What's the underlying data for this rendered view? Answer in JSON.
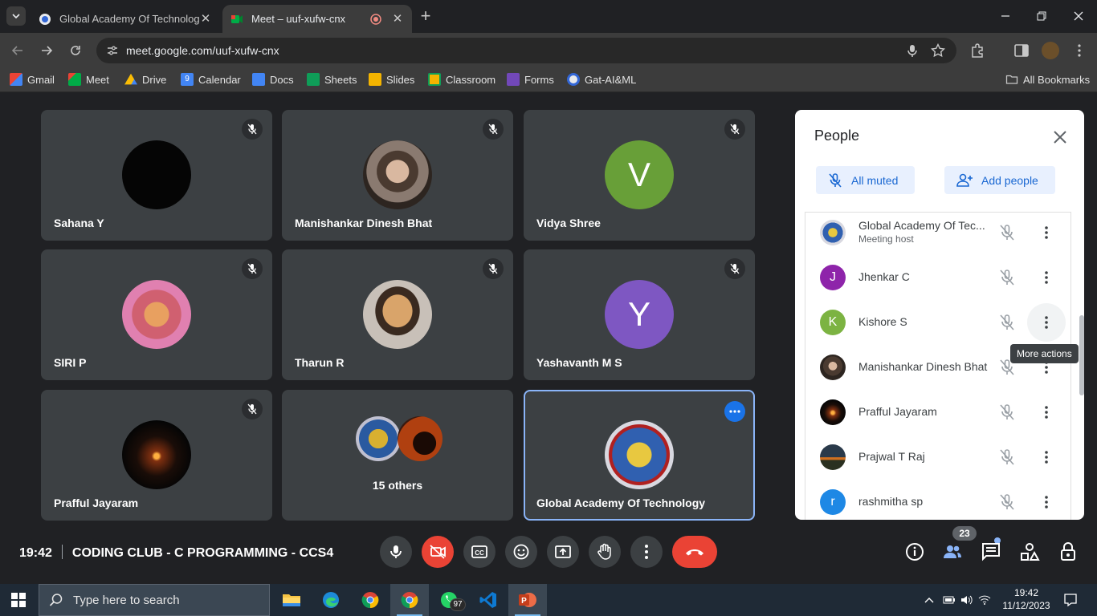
{
  "browser": {
    "tabs": [
      {
        "title": "Global Academy Of Technology",
        "active": false
      },
      {
        "title": "Meet – uuf-xufw-cnx",
        "active": true
      }
    ],
    "url": "meet.google.com/uuf-xufw-cnx",
    "bookmarks": [
      {
        "label": "Gmail",
        "color": "#ea4335"
      },
      {
        "label": "Meet",
        "color": "#00897b"
      },
      {
        "label": "Drive",
        "color": "#fbbc04"
      },
      {
        "label": "Calendar",
        "color": "#4285f4"
      },
      {
        "label": "Docs",
        "color": "#4285f4"
      },
      {
        "label": "Sheets",
        "color": "#0f9d58"
      },
      {
        "label": "Slides",
        "color": "#f4b400"
      },
      {
        "label": "Classroom",
        "color": "#f4b400"
      },
      {
        "label": "Forms",
        "color": "#7248b9"
      },
      {
        "label": "Gat-AI&ML",
        "color": "#8ab4f8"
      }
    ],
    "all_bookmarks": "All Bookmarks"
  },
  "meet": {
    "tiles": [
      {
        "name": "Sahana Y",
        "avatar": "photo-dark",
        "muted": true
      },
      {
        "name": "Manishankar Dinesh Bhat",
        "avatar": "photo-character",
        "muted": true
      },
      {
        "name": "Vidya Shree",
        "avatar_letter": "V",
        "avatar_color": "#689f38",
        "muted": true
      },
      {
        "name": "SIRI P",
        "avatar": "photo-ganesha",
        "muted": true
      },
      {
        "name": "Tharun R",
        "avatar": "photo-cat",
        "muted": true
      },
      {
        "name": "Yashavanth M S",
        "avatar_letter": "Y",
        "avatar_color": "#7e57c2",
        "muted": true
      },
      {
        "name": "Prafful Jayaram",
        "avatar": "photo-sunset",
        "muted": true
      },
      {
        "name": "15 others",
        "avatar": "group"
      },
      {
        "name": "Global Academy Of Technology",
        "avatar": "photo-globe-logo",
        "selected": true
      }
    ],
    "time": "19:42",
    "meeting_title": "CODING CLUB - C PROGRAMMING - CCS4",
    "participant_count": "23"
  },
  "people_panel": {
    "title": "People",
    "all_muted_label": "All muted",
    "add_people_label": "Add people",
    "participants": [
      {
        "name": "Global Academy Of Tec...",
        "sub": "Meeting host",
        "avatar": "photo-globe-logo"
      },
      {
        "name": "Jhenkar C",
        "avatar_letter": "J",
        "avatar_color": "#8e24aa"
      },
      {
        "name": "Kishore S",
        "avatar_letter": "K",
        "avatar_color": "#7cb342"
      },
      {
        "name": "Manishankar Dinesh Bhat",
        "avatar": "photo-character"
      },
      {
        "name": "Prafful Jayaram",
        "avatar": "photo-sunset"
      },
      {
        "name": "Prajwal T Raj",
        "avatar": "photo-landscape"
      },
      {
        "name": "rashmitha sp",
        "avatar_letter": "r",
        "avatar_color": "#1e88e5"
      }
    ],
    "tooltip": "More actions"
  },
  "taskbar": {
    "search_placeholder": "Type here to search",
    "whatsapp_badge": "97",
    "clock_time": "19:42",
    "clock_date": "11/12/2023"
  }
}
